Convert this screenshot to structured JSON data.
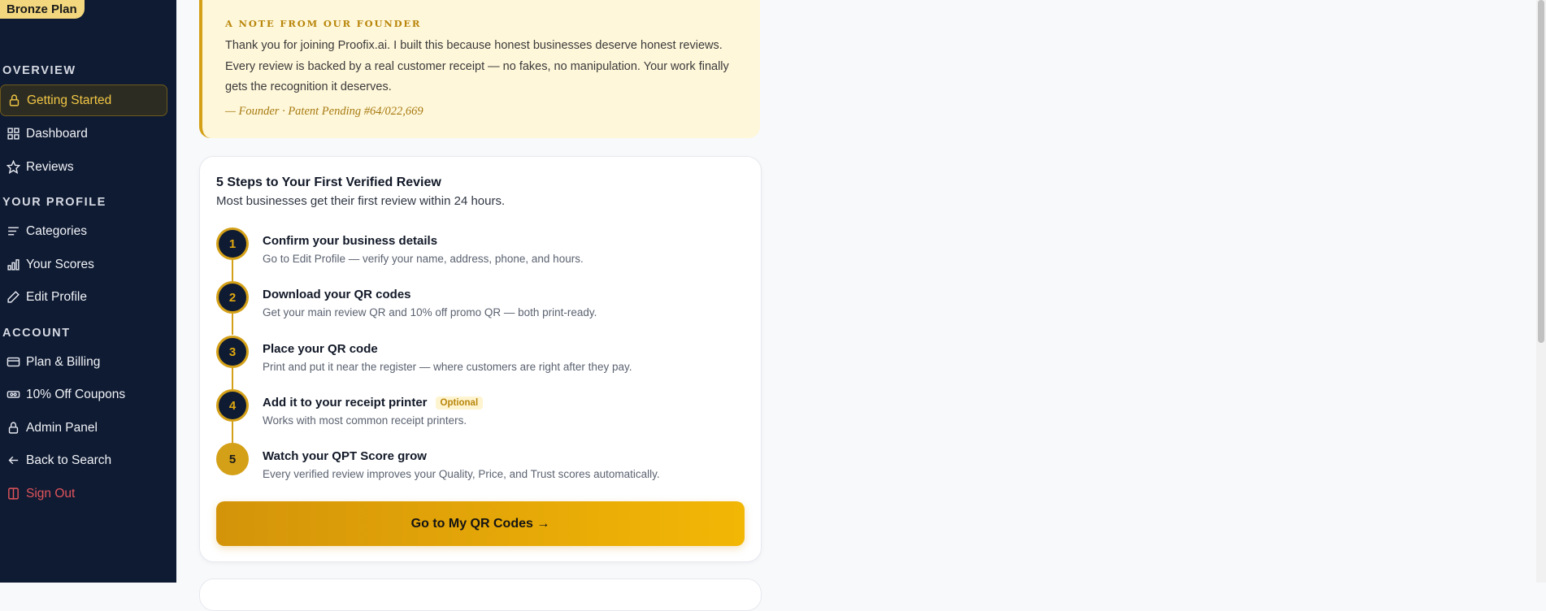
{
  "sidebar": {
    "plan_badge": "Bronze Plan",
    "sections": {
      "overview": "OVERVIEW",
      "profile": "YOUR PROFILE",
      "account": "ACCOUNT"
    },
    "items": [
      {
        "label": "Getting Started",
        "icon": "lock-icon"
      },
      {
        "label": "Dashboard",
        "icon": "grid-icon"
      },
      {
        "label": "Reviews",
        "icon": "star-icon"
      },
      {
        "label": "Categories",
        "icon": "list-icon"
      },
      {
        "label": "Your Scores",
        "icon": "bar-chart-icon"
      },
      {
        "label": "Edit Profile",
        "icon": "pencil-icon"
      },
      {
        "label": "Plan & Billing",
        "icon": "credit-card-icon"
      },
      {
        "label": "10% Off Coupons",
        "icon": "ticket-icon"
      },
      {
        "label": "Admin Panel",
        "icon": "lock-icon"
      },
      {
        "label": "Back to Search",
        "icon": "arrow-left-icon"
      },
      {
        "label": "Sign Out",
        "icon": "sign-out-icon"
      }
    ]
  },
  "founder_note": {
    "title": "A NOTE FROM OUR FOUNDER",
    "line1": "Thank you for joining Proofix.ai. I built this because honest businesses deserve honest reviews.",
    "line2": "Every review is backed by a real customer receipt — no fakes, no manipulation. Your work finally",
    "line3": "gets the recognition it deserves.",
    "signature": "— Founder · Patent Pending #64/022,669"
  },
  "steps_card": {
    "title": "5 Steps to Your First Verified Review",
    "subtitle": "Most businesses get their first review within 24 hours.",
    "steps": [
      {
        "num": "1",
        "title": "Confirm your business details",
        "desc": "Go to Edit Profile — verify your name, address, phone, and hours."
      },
      {
        "num": "2",
        "title": "Download your QR codes",
        "desc": "Get your main review QR and 10% off promo QR — both print-ready."
      },
      {
        "num": "3",
        "title": "Place your QR code",
        "desc": "Print and put it near the register — where customers are right after they pay."
      },
      {
        "num": "4",
        "title": "Add it to your receipt printer",
        "badge": "Optional",
        "desc": "Works with most common receipt printers."
      },
      {
        "num": "5",
        "title": "Watch your QPT Score grow",
        "desc": "Every verified review improves your Quality, Price, and Trust scores automatically."
      }
    ],
    "cta": "Go to My QR Codes →"
  },
  "colors": {
    "sidebar_bg": "#0f1b33",
    "accent_gold": "#d4a017",
    "signout_red": "#e2545b"
  }
}
